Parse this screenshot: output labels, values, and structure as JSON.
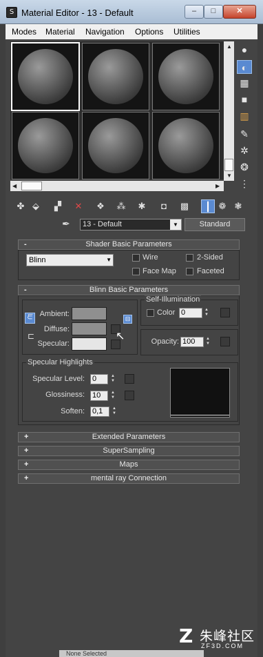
{
  "window": {
    "title": "Material Editor - 13 - Default",
    "controls": {
      "minimize": "–",
      "maximize": "□",
      "close": "✕"
    }
  },
  "menu": [
    "Modes",
    "Material",
    "Navigation",
    "Options",
    "Utilities"
  ],
  "side_toolbar_icons": [
    "sample-type-sphere-icon",
    "backlight-icon",
    "background-checker-icon",
    "sample-uv-tiling-icon",
    "video-color-check-icon",
    "make-preview-icon",
    "options-icon",
    "select-by-material-icon",
    "material-map-navigator-icon"
  ],
  "bottom_toolbar_icons": [
    "get-material-icon",
    "put-to-scene-icon",
    "assign-to-selection-icon",
    "reset-map-icon",
    "make-copy-icon",
    "make-unique-icon",
    "put-to-library-icon",
    "material-id-channel-icon",
    "show-map-in-viewport-icon",
    "show-end-result-icon",
    "go-to-parent-icon",
    "go-forward-to-sibling-icon"
  ],
  "material": {
    "picker_icon": "eyedropper-icon",
    "name": "13 - Default",
    "type": "Standard"
  },
  "shader_basic": {
    "header": "Shader Basic Parameters",
    "sign": "-",
    "shader": "Blinn",
    "wire": "Wire",
    "two_sided": "2-Sided",
    "face_map": "Face Map",
    "faceted": "Faceted"
  },
  "blinn_basic": {
    "header": "Blinn Basic Parameters",
    "sign": "-",
    "ambient": "Ambient:",
    "diffuse": "Diffuse:",
    "specular": "Specular:",
    "self_illum": {
      "label": "Self-Illumination",
      "color_label": "Color",
      "color_value": "0"
    },
    "opacity_label": "Opacity:",
    "opacity_value": "100",
    "colors": {
      "ambient": "#8f8f8f",
      "diffuse": "#8f8f8f",
      "specular": "#e6e6e6"
    }
  },
  "specular_highlights": {
    "label": "Specular Highlights",
    "level_label": "Specular Level:",
    "level_value": "0",
    "gloss_label": "Glossiness:",
    "gloss_value": "10",
    "soften_label": "Soften:",
    "soften_value": "0,1"
  },
  "collapsed_rollouts": [
    {
      "sign": "+",
      "label": "Extended Parameters"
    },
    {
      "sign": "+",
      "label": "SuperSampling"
    },
    {
      "sign": "+",
      "label": "Maps"
    },
    {
      "sign": "+",
      "label": "mental ray Connection"
    }
  ],
  "watermark": {
    "logo": "Z",
    "chinese": "朱峰社区",
    "url": "ZF3D.COM"
  },
  "background_status": "None Selected"
}
